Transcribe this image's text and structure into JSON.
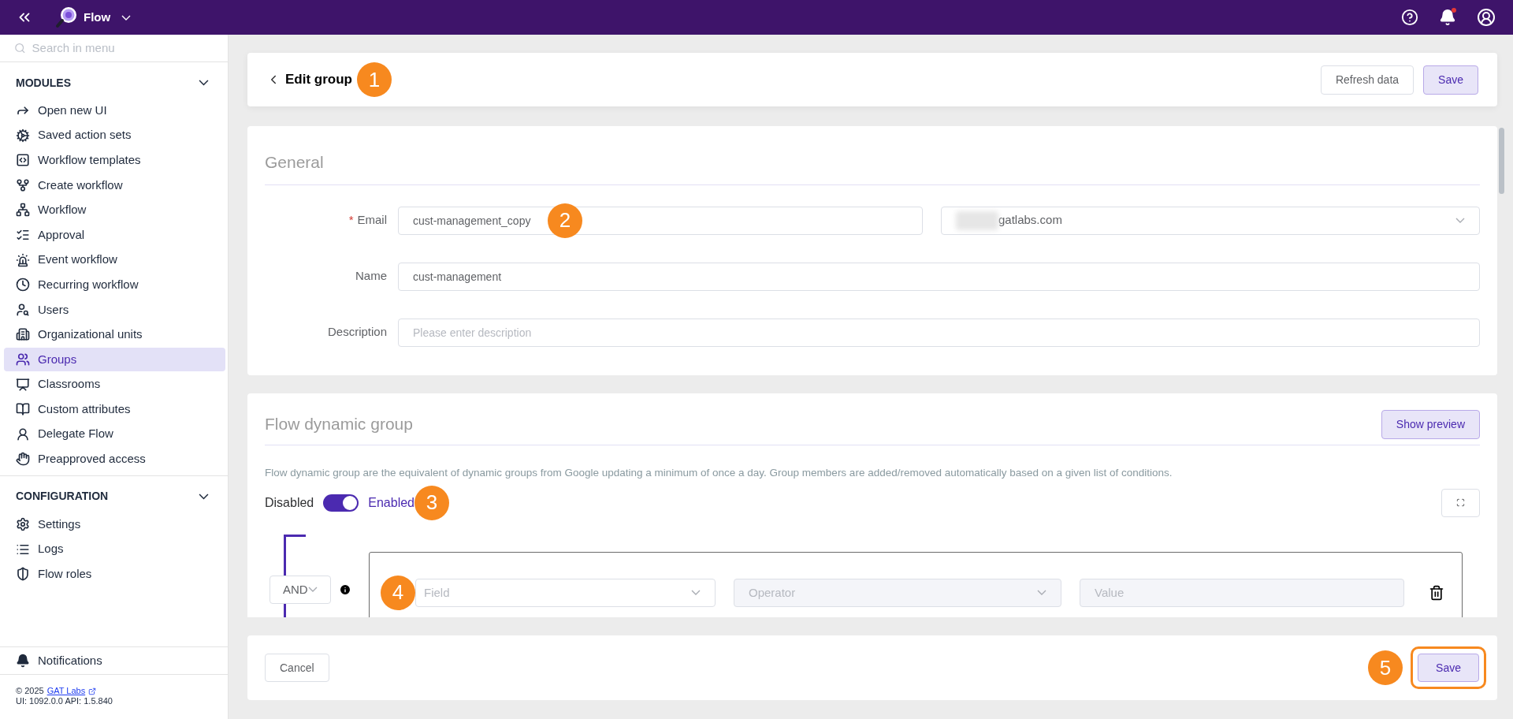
{
  "header": {
    "app_name": "Flow",
    "notification_dot": true
  },
  "sidebar": {
    "search_placeholder": "Search in menu",
    "sections": [
      {
        "title": "MODULES",
        "expanded": true,
        "items": [
          {
            "label": "Open new UI",
            "selected": false
          },
          {
            "label": "Saved action sets",
            "selected": false
          },
          {
            "label": "Workflow templates",
            "selected": false
          },
          {
            "label": "Create workflow",
            "selected": false
          },
          {
            "label": "Workflow",
            "selected": false
          },
          {
            "label": "Approval",
            "selected": false
          },
          {
            "label": "Event workflow",
            "selected": false
          },
          {
            "label": "Recurring workflow",
            "selected": false
          },
          {
            "label": "Users",
            "selected": false
          },
          {
            "label": "Organizational units",
            "selected": false
          },
          {
            "label": "Groups",
            "selected": true
          },
          {
            "label": "Classrooms",
            "selected": false
          },
          {
            "label": "Custom attributes",
            "selected": false
          },
          {
            "label": "Delegate Flow",
            "selected": false
          },
          {
            "label": "Preapproved access",
            "selected": false
          }
        ]
      },
      {
        "title": "CONFIGURATION",
        "expanded": true,
        "items": [
          {
            "label": "Settings",
            "selected": false
          },
          {
            "label": "Logs",
            "selected": false
          },
          {
            "label": "Flow roles",
            "selected": false
          }
        ]
      }
    ],
    "notifications": "Notifications",
    "footer": {
      "copyright": "© 2025",
      "link": "GAT Labs",
      "version": "UI: 1092.0.0 API: 1.5.840"
    }
  },
  "page": {
    "title": "Edit group",
    "callout": "1",
    "buttons": [
      {
        "label": "Refresh data",
        "kind": "secondary"
      },
      {
        "label": "Save",
        "kind": "primary"
      }
    ]
  },
  "general": {
    "title": "General",
    "fields": [
      {
        "label": "Email",
        "required_mark": "*",
        "value": "cust-management_copy",
        "callout": "2",
        "domain": "gatlabs.com"
      },
      {
        "label": "Name",
        "value": "cust-management"
      },
      {
        "label": "Description",
        "placeholder": "Please enter description"
      }
    ]
  },
  "dynamic": {
    "title": "Flow dynamic group",
    "preview_button": "Show preview",
    "description": "Flow dynamic group are the equivalent of dynamic groups from Google updating a minimum of once a day. Group members are added/removed automatically based on a given list of conditions.",
    "toggle": {
      "off_label": "Disabled",
      "on_label": "Enabled",
      "on": true,
      "callout": "3"
    },
    "condition": {
      "operator": "AND",
      "callout": "4",
      "field_placeholder": "Field",
      "operator_placeholder": "Operator",
      "value_placeholder": "Value"
    }
  },
  "footer": {
    "cancel": "Cancel",
    "save": "Save",
    "callout": "5",
    "highlighted": true
  }
}
